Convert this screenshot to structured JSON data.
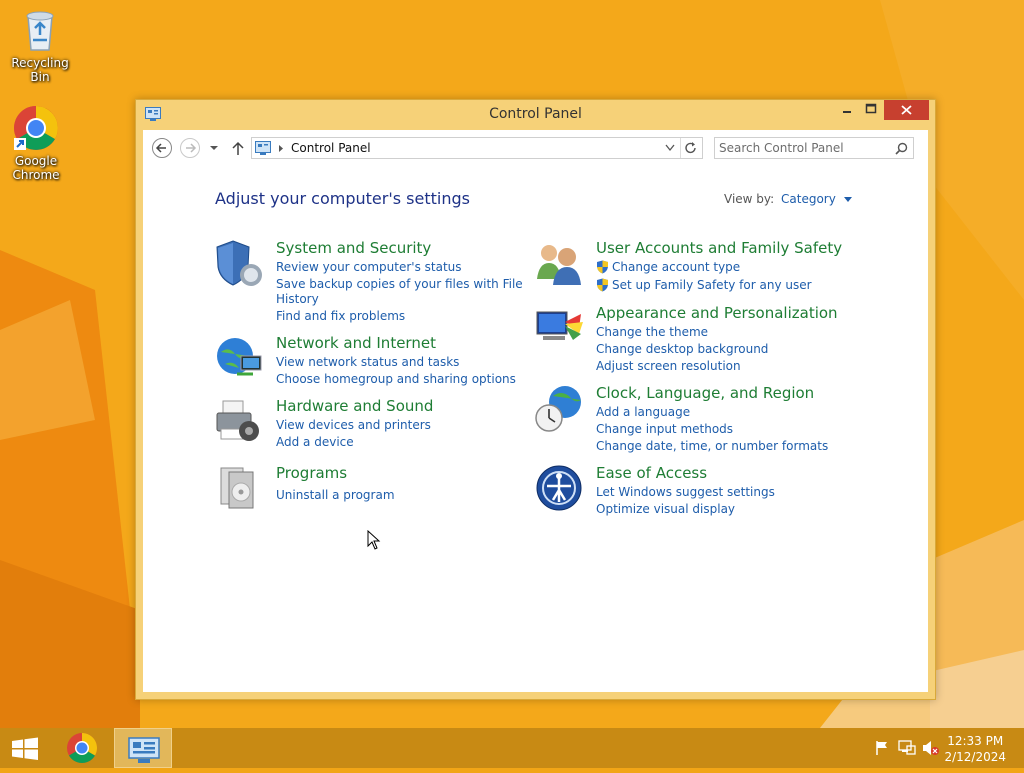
{
  "desktop": {
    "icons": [
      {
        "label": "Recycling Bin",
        "icon": "recycle-bin-icon"
      },
      {
        "label": "Google Chrome",
        "icon": "chrome-icon"
      }
    ]
  },
  "window": {
    "title": "Control Panel",
    "address": {
      "crumb": "Control Panel"
    },
    "search": {
      "placeholder": "Search Control Panel"
    },
    "heading": "Adjust your computer's settings",
    "view_by_label": "View by:",
    "view_by_value": "Category",
    "categories": [
      {
        "title": "System and Security",
        "icon": "shield-icon",
        "links": [
          "Review your computer's status",
          "Save backup copies of your files with File",
          "History",
          "Find and fix problems"
        ]
      },
      {
        "title": "Network and Internet",
        "icon": "network-icon",
        "links": [
          "View network status and tasks",
          "Choose homegroup and sharing options"
        ]
      },
      {
        "title": "Hardware and Sound",
        "icon": "printer-icon",
        "links": [
          "View devices and printers",
          "Add a device"
        ]
      },
      {
        "title": "Programs",
        "icon": "programs-icon",
        "links": [
          "Uninstall a program"
        ]
      },
      {
        "title": "User Accounts and Family Safety",
        "icon": "users-icon",
        "links": [
          "Change account type",
          "Set up Family Safety for any user"
        ]
      },
      {
        "title": "Appearance and Personalization",
        "icon": "appearance-icon",
        "links": [
          "Change the theme",
          "Change desktop background",
          "Adjust screen resolution"
        ]
      },
      {
        "title": "Clock, Language, and Region",
        "icon": "clock-globe-icon",
        "links": [
          "Add a language",
          "Change input methods",
          "Change date, time, or number formats"
        ]
      },
      {
        "title": "Ease of Access",
        "icon": "ease-of-access-icon",
        "links": [
          "Let Windows suggest settings",
          "Optimize visual display"
        ]
      }
    ]
  },
  "taskbar": {
    "time": "12:33 PM",
    "date": "2/12/2024"
  },
  "colors": {
    "desktop": "#f4a81a",
    "taskbar": "#c88a14",
    "category_title": "#1e7d34",
    "link": "#1e5dab",
    "close_button": "#c7402f"
  }
}
